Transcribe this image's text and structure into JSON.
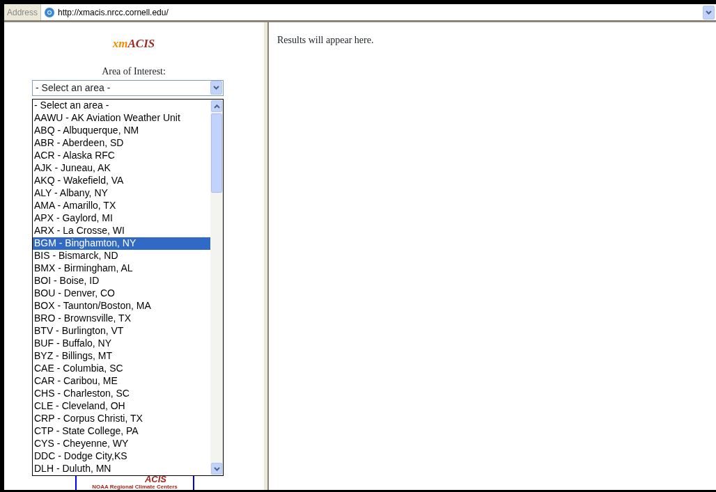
{
  "address_bar": {
    "label": "Address",
    "url": "http://xmacis.nrcc.cornell.edu/"
  },
  "left_frame": {
    "title_parts": [
      "xm",
      "ACIS"
    ],
    "area_label": "Area of Interest:",
    "select": {
      "value": "- Select an area -",
      "expanded": true,
      "options": [
        {
          "label": "- Select an area -",
          "highlighted": false
        },
        {
          "label": "AAWU - AK Aviation Weather Unit",
          "highlighted": false
        },
        {
          "label": "ABQ - Albuquerque, NM",
          "highlighted": false
        },
        {
          "label": "ABR - Aberdeen, SD",
          "highlighted": false
        },
        {
          "label": "ACR - Alaska RFC",
          "highlighted": false
        },
        {
          "label": "AJK - Juneau, AK",
          "highlighted": false
        },
        {
          "label": "AKQ - Wakefield, VA",
          "highlighted": false
        },
        {
          "label": "ALY - Albany, NY",
          "highlighted": false
        },
        {
          "label": "AMA - Amarillo, TX",
          "highlighted": false
        },
        {
          "label": "APX - Gaylord, MI",
          "highlighted": false
        },
        {
          "label": "ARX - La Crosse, WI",
          "highlighted": false
        },
        {
          "label": "BGM - Binghamton, NY",
          "highlighted": true
        },
        {
          "label": "BIS - Bismarck, ND",
          "highlighted": false
        },
        {
          "label": "BMX - Birmingham, AL",
          "highlighted": false
        },
        {
          "label": "BOI - Boise, ID",
          "highlighted": false
        },
        {
          "label": "BOU - Denver, CO",
          "highlighted": false
        },
        {
          "label": "BOX - Taunton/Boston, MA",
          "highlighted": false
        },
        {
          "label": "BRO - Brownsville, TX",
          "highlighted": false
        },
        {
          "label": "BTV - Burlington, VT",
          "highlighted": false
        },
        {
          "label": "BUF - Buffalo, NY",
          "highlighted": false
        },
        {
          "label": "BYZ - Billings, MT",
          "highlighted": false
        },
        {
          "label": "CAE - Columbia, SC",
          "highlighted": false
        },
        {
          "label": "CAR - Caribou, ME",
          "highlighted": false
        },
        {
          "label": "CHS - Charleston, SC",
          "highlighted": false
        },
        {
          "label": "CLE - Cleveland, OH",
          "highlighted": false
        },
        {
          "label": "CRP - Corpus Christi, TX",
          "highlighted": false
        },
        {
          "label": "CTP - State College, PA",
          "highlighted": false
        },
        {
          "label": "CYS - Cheyenne, WY",
          "highlighted": false
        },
        {
          "label": "DDC - Dodge City,KS",
          "highlighted": false
        },
        {
          "label": "DLH - Duluth, MN",
          "highlighted": false
        }
      ]
    },
    "logo": {
      "text": "ACIS",
      "caption": "NOAA Regional Climate Centers"
    }
  },
  "right_frame": {
    "message": "Results will appear here."
  }
}
